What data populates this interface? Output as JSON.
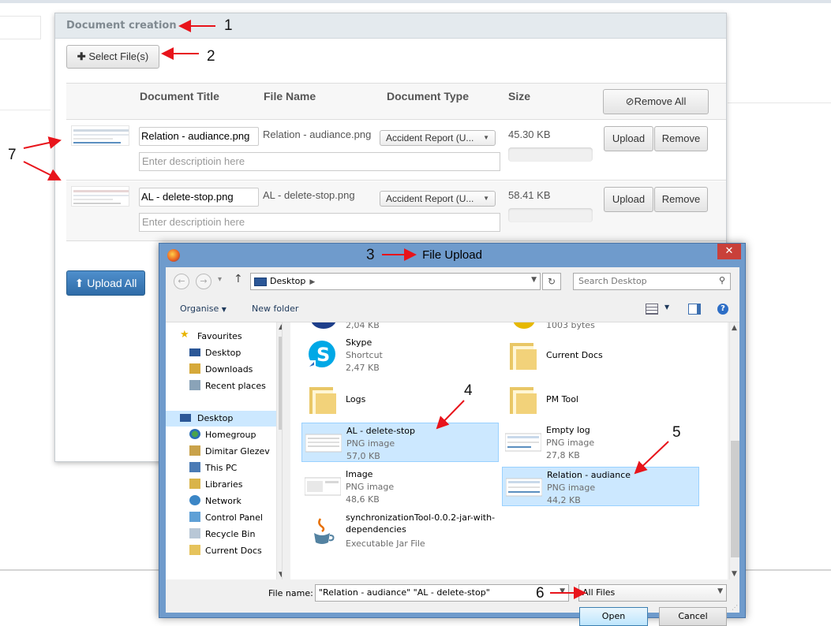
{
  "panel": {
    "title": "Document creation",
    "select_files_label": "Select File(s)",
    "columns": {
      "title": "Document Title",
      "file_name": "File Name",
      "type": "Document Type",
      "size": "Size"
    },
    "remove_all_label": "Remove All",
    "rows": [
      {
        "title": "Relation - audiance.png",
        "file_name": "Relation - audiance.png",
        "type": "Accident Report (U...",
        "size": "45.30 KB",
        "desc_placeholder": "Enter descriptioin here",
        "upload_label": "Upload",
        "remove_label": "Remove"
      },
      {
        "title": "AL - delete-stop.png",
        "file_name": "AL - delete-stop.png",
        "type": "Accident Report (U...",
        "size": "58.41 KB",
        "desc_placeholder": "Enter descriptioin here",
        "upload_label": "Upload",
        "remove_label": "Remove"
      }
    ],
    "upload_all_label": "Upload All"
  },
  "annotations": {
    "a1": "1",
    "a2": "2",
    "a3": "3",
    "a4": "4",
    "a5": "5",
    "a6": "6",
    "a7": "7"
  },
  "dialog": {
    "title": "File Upload",
    "address": "Desktop",
    "search_placeholder": "Search Desktop",
    "organise_label": "Organise",
    "new_folder_label": "New folder",
    "nav_items": [
      {
        "label": "Favourites",
        "icon": "star-icon"
      },
      {
        "label": "Desktop",
        "icon": "desktop-icon"
      },
      {
        "label": "Downloads",
        "icon": "downloads-icon"
      },
      {
        "label": "Recent places",
        "icon": "recent-places-icon"
      },
      {
        "label": "Desktop",
        "icon": "desktop-icon"
      },
      {
        "label": "Homegroup",
        "icon": "homegroup-icon"
      },
      {
        "label": "Dimitar Glezev",
        "icon": "user-folder-icon"
      },
      {
        "label": "This PC",
        "icon": "computer-icon"
      },
      {
        "label": "Libraries",
        "icon": "libraries-icon"
      },
      {
        "label": "Network",
        "icon": "network-icon"
      },
      {
        "label": "Control Panel",
        "icon": "control-panel-icon"
      },
      {
        "label": "Recycle Bin",
        "icon": "recycle-bin-icon"
      },
      {
        "label": "Current Docs",
        "icon": "folder-icon"
      }
    ],
    "files": [
      {
        "name": "",
        "type": "",
        "size": "2,04 KB"
      },
      {
        "name": "",
        "type": "",
        "size": "1003 bytes"
      },
      {
        "name": "Skype",
        "type": "Shortcut",
        "size": "2,47 KB"
      },
      {
        "name": "Current Docs",
        "type": "",
        "size": ""
      },
      {
        "name": "Logs",
        "type": "",
        "size": ""
      },
      {
        "name": "PM Tool",
        "type": "",
        "size": ""
      },
      {
        "name": "AL - delete-stop",
        "type": "PNG image",
        "size": "57,0 KB"
      },
      {
        "name": "Empty log",
        "type": "PNG image",
        "size": "27,8 KB"
      },
      {
        "name": "Image",
        "type": "PNG image",
        "size": "48,6 KB"
      },
      {
        "name": "Relation - audiance",
        "type": "PNG image",
        "size": "44,2 KB"
      },
      {
        "name": "synchronizationTool-0.0.2-jar-with-dependencies",
        "type": "Executable Jar File",
        "size": ""
      }
    ],
    "file_name_label": "File name:",
    "file_name_value": "\"Relation - audiance\" \"AL - delete-stop\"",
    "filter_value": "All Files",
    "open_label": "Open",
    "cancel_label": "Cancel"
  },
  "colors": {
    "accent": "#2f6ca8",
    "selection": "#cce8ff",
    "arrow": "#e8141b",
    "titlebar": "#6f9bcc"
  }
}
